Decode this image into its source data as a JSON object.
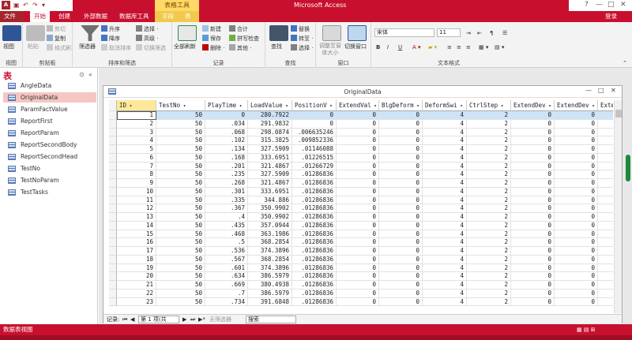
{
  "app": {
    "title": "Microsoft Access",
    "logo": "A",
    "context_tab_group": "表格工具",
    "login": "登录"
  },
  "tabs": [
    {
      "label": "文件",
      "type": "file"
    },
    {
      "label": "开始",
      "type": "active"
    },
    {
      "label": "创建",
      "type": "normal"
    },
    {
      "label": "外部数据",
      "type": "normal"
    },
    {
      "label": "数据库工具",
      "type": "normal"
    },
    {
      "label": "字段",
      "type": "normal"
    },
    {
      "label": "表",
      "type": "normal"
    }
  ],
  "ribbon": {
    "view": {
      "btn": "视图",
      "group": "视图"
    },
    "clipboard": {
      "paste": "粘贴",
      "cut": "剪切",
      "copy": "复制",
      "painter": "格式刷",
      "group": "剪贴板"
    },
    "sort": {
      "filter": "筛选器",
      "asc": "升序",
      "desc": "降序",
      "remove": "取消排序",
      "select": "选择 ·",
      "advanced": "高级 ·",
      "toggle": "切换筛选",
      "group": "排序和筛选"
    },
    "records": {
      "refresh": "全部刷新",
      "new": "新建",
      "save": "保存",
      "delete": "删除 ·",
      "totals": "合计",
      "spell": "拼写检查",
      "more": "其他 ·",
      "group": "记录"
    },
    "find": {
      "find": "查找",
      "replace": "替换",
      "goto": "转至 ·",
      "select": "选择 ·",
      "group": "查找"
    },
    "window": {
      "fit": "调整至窗体大小",
      "switch": "切换窗口",
      "group": "窗口"
    },
    "text": {
      "font": "宋体",
      "size": "11",
      "bold": "B",
      "italic": "I",
      "underline": "U",
      "group": "文本格式"
    }
  },
  "nav": {
    "title": "表",
    "items": [
      "AngleData",
      "OriginalData",
      "ParamFactValue",
      "ReportFirst",
      "ReportParam",
      "ReportSecondBody",
      "ReportSecondHead",
      "TestNo",
      "TestNoParam",
      "TestTasks"
    ],
    "selected": "OriginalData"
  },
  "doc": {
    "title": "OriginalData",
    "min": "—",
    "max": "□",
    "close": "✕"
  },
  "grid": {
    "columns": [
      "ID",
      "TestNo",
      "PlayTime",
      "LoadValue",
      "PositionV",
      "ExtendVal",
      "BlgDeform",
      "DeformSwi",
      "CtrlStep",
      "ExtendDev",
      "ExtendDev",
      "Exter"
    ],
    "rows": [
      [
        "1",
        "50",
        "0",
        "280.7922",
        "0",
        "0",
        "0",
        "4",
        "2",
        "0",
        "0"
      ],
      [
        "2",
        "50",
        ".034",
        "291.9832",
        "0",
        "0",
        "0",
        "4",
        "2",
        "0",
        "0"
      ],
      [
        "3",
        "50",
        ".068",
        "298.0874",
        ".006635246",
        "0",
        "0",
        "4",
        "2",
        "0",
        "0"
      ],
      [
        "4",
        "50",
        ".102",
        "315.3825",
        ".009852336",
        "0",
        "0",
        "4",
        "2",
        "0",
        "0"
      ],
      [
        "5",
        "50",
        ".134",
        "327.5909",
        ".01146088",
        "0",
        "0",
        "4",
        "2",
        "0",
        "0"
      ],
      [
        "6",
        "50",
        ".168",
        "333.6951",
        ".01226515",
        "0",
        "0",
        "4",
        "2",
        "0",
        "0"
      ],
      [
        "7",
        "50",
        ".201",
        "321.4867",
        ".01266729",
        "0",
        "0",
        "4",
        "2",
        "0",
        "0"
      ],
      [
        "8",
        "50",
        ".235",
        "327.5909",
        ".01286836",
        "0",
        "0",
        "4",
        "2",
        "0",
        "0"
      ],
      [
        "9",
        "50",
        ".268",
        "321.4867",
        ".01286836",
        "0",
        "0",
        "4",
        "2",
        "0",
        "0"
      ],
      [
        "10",
        "50",
        ".301",
        "333.6951",
        ".01286836",
        "0",
        "0",
        "4",
        "2",
        "0",
        "0"
      ],
      [
        "11",
        "50",
        ".335",
        "344.886",
        ".01286836",
        "0",
        "0",
        "4",
        "2",
        "0",
        "0"
      ],
      [
        "12",
        "50",
        ".367",
        "350.9902",
        ".01286836",
        "0",
        "0",
        "4",
        "2",
        "0",
        "0"
      ],
      [
        "13",
        "50",
        ".4",
        "350.9902",
        ".01286836",
        "0",
        "0",
        "4",
        "2",
        "0",
        "0"
      ],
      [
        "14",
        "50",
        ".435",
        "357.0944",
        ".01286836",
        "0",
        "0",
        "4",
        "2",
        "0",
        "0"
      ],
      [
        "15",
        "50",
        ".468",
        "363.1986",
        ".01286836",
        "0",
        "0",
        "4",
        "2",
        "0",
        "0"
      ],
      [
        "16",
        "50",
        ".5",
        "368.2854",
        ".01286836",
        "0",
        "0",
        "4",
        "2",
        "0",
        "0"
      ],
      [
        "17",
        "50",
        ".536",
        "374.3896",
        ".01286836",
        "0",
        "0",
        "4",
        "2",
        "0",
        "0"
      ],
      [
        "18",
        "50",
        ".567",
        "368.2854",
        ".01286836",
        "0",
        "0",
        "4",
        "2",
        "0",
        "0"
      ],
      [
        "19",
        "50",
        ".601",
        "374.3896",
        ".01286836",
        "0",
        "0",
        "4",
        "2",
        "0",
        "0"
      ],
      [
        "20",
        "50",
        ".634",
        "386.5979",
        ".01286836",
        "0",
        "0",
        "4",
        "2",
        "0",
        "0"
      ],
      [
        "21",
        "50",
        ".669",
        "380.4938",
        ".01286836",
        "0",
        "0",
        "4",
        "2",
        "0",
        "0"
      ],
      [
        "22",
        "50",
        ".7",
        "386.5979",
        ".01286836",
        "0",
        "0",
        "4",
        "2",
        "0",
        "0"
      ],
      [
        "23",
        "50",
        ".734",
        "391.6848",
        ".01286836",
        "0",
        "0",
        "4",
        "2",
        "0",
        "0"
      ]
    ]
  },
  "recnav": {
    "label": "记录:",
    "first": "⏮",
    "prev": "◀",
    "position": "第 1 项(共 5815",
    "next": "▶",
    "last": "⏭",
    "new": "▶*",
    "nofilter": "无筛选器",
    "search": "搜索"
  },
  "status": {
    "text": "数据表视图"
  }
}
